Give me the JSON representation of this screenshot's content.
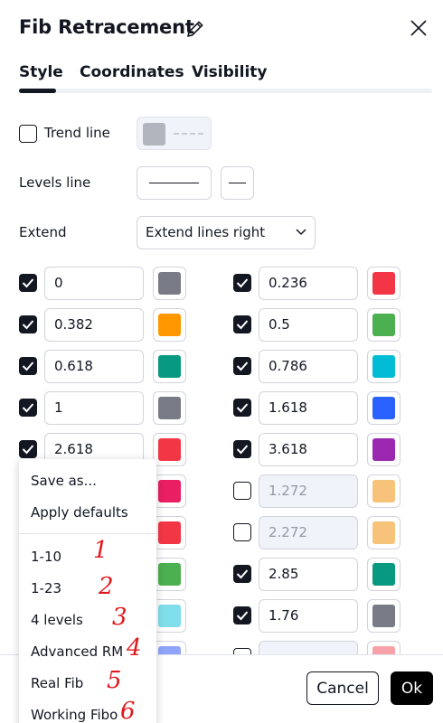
{
  "header": {
    "title": "Fib Retracement"
  },
  "tabs": [
    {
      "label": "Style"
    },
    {
      "label": "Coordinates"
    },
    {
      "label": "Visibility"
    }
  ],
  "style": {
    "trend_line_label": "Trend line",
    "trend_line_color": "#b2b5be",
    "levels_line_label": "Levels line",
    "extend_label": "Extend",
    "extend_value": "Extend lines right"
  },
  "levels": [
    {
      "value": "0",
      "color": "#787b86",
      "checked": true,
      "disabled": false
    },
    {
      "value": "0.236",
      "color": "#f23645",
      "checked": true,
      "disabled": false
    },
    {
      "value": "0.382",
      "color": "#ff9800",
      "checked": true,
      "disabled": false
    },
    {
      "value": "0.5",
      "color": "#4caf50",
      "checked": true,
      "disabled": false
    },
    {
      "value": "0.618",
      "color": "#089981",
      "checked": true,
      "disabled": false
    },
    {
      "value": "0.786",
      "color": "#00bcd4",
      "checked": true,
      "disabled": false
    },
    {
      "value": "1",
      "color": "#787b86",
      "checked": true,
      "disabled": false
    },
    {
      "value": "1.618",
      "color": "#2962ff",
      "checked": true,
      "disabled": false
    },
    {
      "value": "2.618",
      "color": "#f23645",
      "checked": true,
      "disabled": false
    },
    {
      "value": "3.618",
      "color": "#9c27b0",
      "checked": true,
      "disabled": false
    },
    {
      "value": "",
      "color": "#e91e63",
      "checked": true,
      "disabled": false
    },
    {
      "value": "1.272",
      "color": "#f7c27a",
      "checked": false,
      "disabled": true
    },
    {
      "value": "",
      "color": "#f23645",
      "checked": true,
      "disabled": false
    },
    {
      "value": "2.272",
      "color": "#f7c27a",
      "checked": false,
      "disabled": true
    },
    {
      "value": "",
      "color": "#4caf50",
      "checked": true,
      "disabled": false
    },
    {
      "value": "2.85",
      "color": "#089981",
      "checked": true,
      "disabled": false
    },
    {
      "value": "",
      "color": "#80deea",
      "checked": true,
      "disabled": false
    },
    {
      "value": "1.76",
      "color": "#787b86",
      "checked": true,
      "disabled": false
    },
    {
      "value": "",
      "color": "#90a4f9",
      "checked": true,
      "disabled": false
    },
    {
      "value": "",
      "color": "#f7a1a8",
      "checked": false,
      "disabled": true
    }
  ],
  "template_menu": {
    "items": [
      "Save as...",
      "Apply defaults",
      "1-10",
      "1-23",
      "4 levels",
      "Advanced RM",
      "Real Fib",
      "Working Fibo"
    ],
    "annotations": [
      "1",
      "2",
      "3",
      "4",
      "5",
      "6"
    ]
  },
  "footer": {
    "cancel_label": "Cancel",
    "ok_label": "Ok"
  }
}
